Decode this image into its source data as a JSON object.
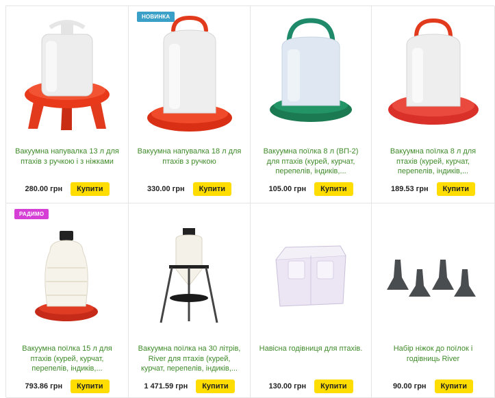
{
  "products": [
    {
      "title": "Вакуумна напувалка 13 л для птахів з ручкою і з ніжками",
      "price": "280.00 грн",
      "buy": "Купити",
      "badge": "",
      "image": "red-feeder-with-legs"
    },
    {
      "title": "Вакуумна напувалка 18 л для птахів з ручкою",
      "price": "330.00 грн",
      "buy": "Купити",
      "badge": "НОВИНКА",
      "image": "red-drinker-with-handle"
    },
    {
      "title": "Вакуумна поїлка 8 л (ВП-2) для птахів (курей, курчат, перепелів, індиків,...",
      "price": "105.00 грн",
      "buy": "Купити",
      "badge": "",
      "image": "green-drinker"
    },
    {
      "title": "Вакуумна поїлка 8 л для птахів (курей, курчат, перепелів, індиків,...",
      "price": "189.53 грн",
      "buy": "Купити",
      "badge": "",
      "image": "red-drinker-8l"
    },
    {
      "title": "Вакуумна поїлка 15 л для птахів (курей, курчат, перепелів, індиків,...",
      "price": "793.86 грн",
      "buy": "Купити",
      "badge": "РАДИМО",
      "image": "white-drinker-15l"
    },
    {
      "title": "Вакуумна поїлка на 30 літрів, River для птахів (курей, курчат, перепелів, індиків,...",
      "price": "1 471.59 грн",
      "buy": "Купити",
      "badge": "",
      "image": "stand-drinker-30l"
    },
    {
      "title": "Навісна годівниця для птахів.",
      "price": "130.00 грн",
      "buy": "Купити",
      "badge": "",
      "image": "hanging-feeder"
    },
    {
      "title": "Набір ніжок до поїлок і годівниць River",
      "price": "90.00 грн",
      "buy": "Купити",
      "badge": "",
      "image": "legs-set"
    }
  ],
  "colors": {
    "title_link": "#3f8a2a",
    "buy_button": "#ffdd00",
    "badge_new": "#3aa0c8",
    "badge_recommend": "#d63fd6"
  }
}
